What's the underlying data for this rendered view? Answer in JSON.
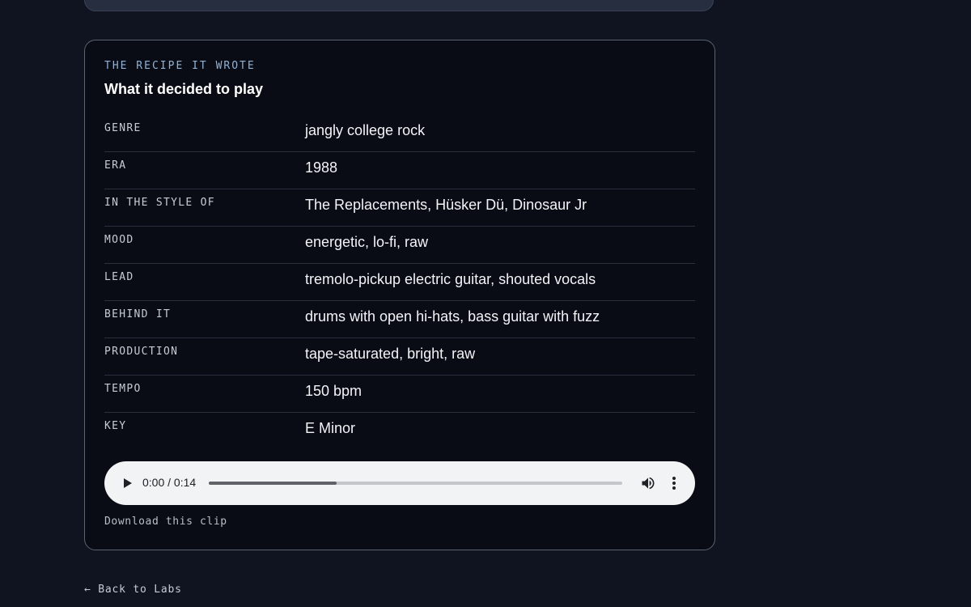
{
  "recipe": {
    "eyebrow": "THE RECIPE IT WROTE",
    "title": "What it decided to play",
    "rows": [
      {
        "label": "GENRE",
        "value": "jangly college rock"
      },
      {
        "label": "ERA",
        "value": "1988"
      },
      {
        "label": "IN THE STYLE OF",
        "value": "The Replacements, Hüsker Dü, Dinosaur Jr"
      },
      {
        "label": "MOOD",
        "value": "energetic, lo-fi, raw"
      },
      {
        "label": "LEAD",
        "value": "tremolo-pickup electric guitar, shouted vocals"
      },
      {
        "label": "BEHIND IT",
        "value": "drums with open hi-hats, bass guitar with fuzz"
      },
      {
        "label": "PRODUCTION",
        "value": "tape-saturated, bright, raw"
      },
      {
        "label": "TEMPO",
        "value": "150 bpm"
      },
      {
        "label": "KEY",
        "value": "E Minor"
      }
    ]
  },
  "player": {
    "time": "0:00 / 0:14",
    "progress": 0.31,
    "play_icon": "play-icon",
    "volume_icon": "volume-icon",
    "more_icon": "more-vert-icon"
  },
  "download_label": "Download this clip",
  "back_label": "← Back to Labs",
  "colors": {
    "page_bg": "#0f1420",
    "card_bg": "#090c14",
    "eyebrow": "#8fb2d6",
    "player_bg": "#f1f3f4"
  }
}
